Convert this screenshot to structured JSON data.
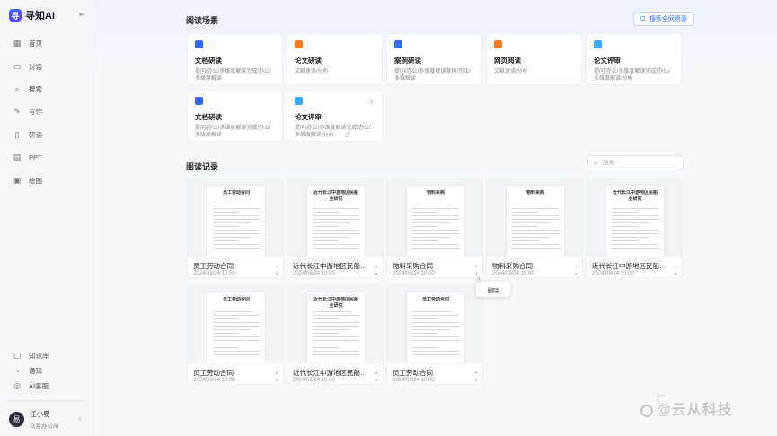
{
  "brand": {
    "name": "寻知AI",
    "logo": "寻"
  },
  "sidebar": {
    "nav": [
      {
        "label": "首页",
        "icon": "grid-icon"
      },
      {
        "label": "对话",
        "icon": "chat-icon"
      },
      {
        "label": "搜索",
        "icon": "search-icon"
      },
      {
        "label": "写作",
        "icon": "pen-icon"
      },
      {
        "label": "研读",
        "icon": "book-icon"
      },
      {
        "label": "PPT",
        "icon": "slides-icon"
      },
      {
        "label": "绘图",
        "icon": "image-icon"
      }
    ],
    "bottom": [
      {
        "label": "知识库",
        "icon": "library-icon"
      },
      {
        "label": "通知",
        "icon": "bell-icon"
      },
      {
        "label": "AI客服",
        "icon": "support-icon"
      }
    ],
    "user": {
      "name": "江小易",
      "org": "众易办公AI",
      "avatar": "易"
    }
  },
  "scenes": {
    "title": "阅读场景",
    "link": "搜索全网资源",
    "items": [
      {
        "name": "文档研读",
        "desc": "提问/办公/多维度解读完成/办公/多级原解读",
        "color": "#2f6bff"
      },
      {
        "name": "论文研读",
        "desc": "文献速读/分析",
        "color": "#ff7a1a"
      },
      {
        "name": "案例研读",
        "desc": "提问/办公/多维度解读案例/司法/多维解读",
        "color": "#2f6bff"
      },
      {
        "name": "网页阅读",
        "desc": "文献速读/分析",
        "color": "#ff7a1a"
      },
      {
        "name": "论文评审",
        "desc": "提问/办公/多维度解读完成/办公/多维度解读/分析",
        "color": "#3aa8ff"
      },
      {
        "name": "文档研读",
        "desc": "提问/办公/多维度解读完成/办公/多级原解读",
        "color": "#2f6bff"
      },
      {
        "name": "论文评审",
        "desc": "提问/办公/多维度解读完成/办公/多维度解读/分析",
        "color": "#3aa8ff"
      }
    ]
  },
  "records": {
    "title": "阅读记录",
    "search_placeholder": "搜索",
    "items": [
      {
        "name": "员工劳动合同",
        "date": "2024/09/24 10:00",
        "thumb": "员工劳动合同"
      },
      {
        "name": "近代长江中游地区民船业研究",
        "date": "2024/09/24 10:00",
        "thumb": "近代长江中游地区民船业研究"
      },
      {
        "name": "物料采购合同",
        "date": "2024/09/24 10:00",
        "thumb": "物料采购"
      },
      {
        "name": "物料采购合同",
        "date": "2024/09/24 10:00",
        "thumb": "物料采购"
      },
      {
        "name": "近代长江中游地区民船业研究",
        "date": "2024/09/24 10:00",
        "thumb": "近代长江中游地区民船业研究"
      },
      {
        "name": "员工劳动合同",
        "date": "2024/09/24 10:00",
        "thumb": "员工劳动合同"
      },
      {
        "name": "近代长江中游地区民船业研究",
        "date": "2024/09/24 10:00",
        "thumb": "近代长江中游地区民船业研究"
      },
      {
        "name": "员工劳动合同",
        "date": "2024/09/24 10:00",
        "thumb": "员工劳动合同"
      }
    ],
    "menu_delete": "删除"
  },
  "watermark": "@云从科技"
}
